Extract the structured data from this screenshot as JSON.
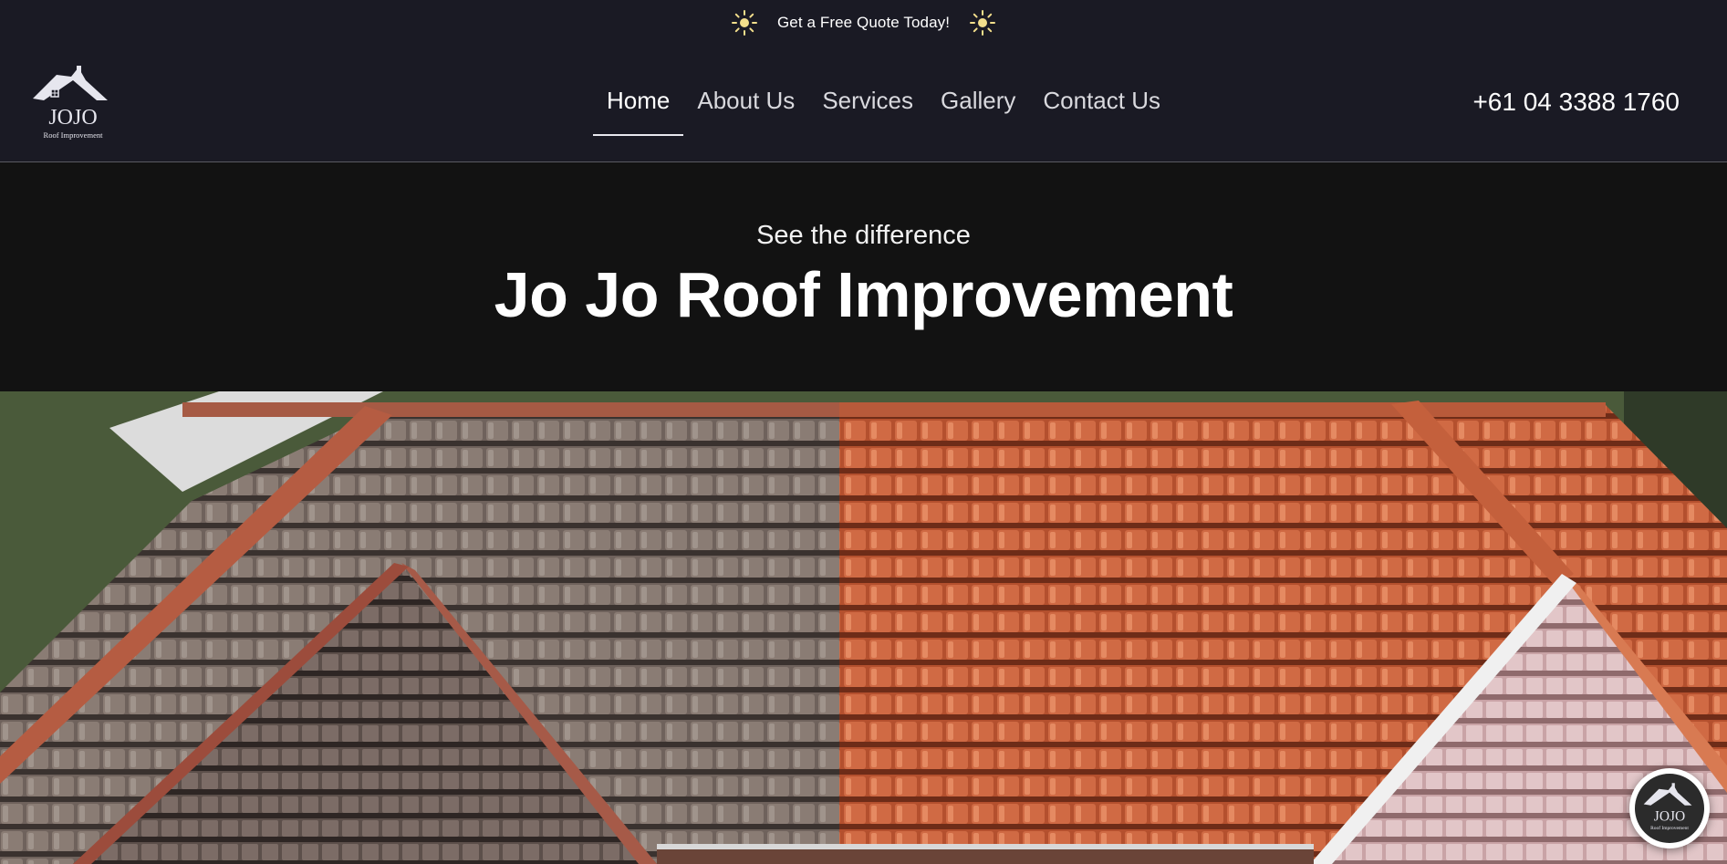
{
  "announcement": {
    "text": "Get a Free Quote Today!",
    "icon": "sun-icon",
    "icon_color": "#f3df8c"
  },
  "header": {
    "logo": {
      "brand": "JOJO",
      "tagline": "Roof Improvement"
    },
    "nav": [
      {
        "label": "Home",
        "active": true
      },
      {
        "label": "About Us",
        "active": false
      },
      {
        "label": "Services",
        "active": false
      },
      {
        "label": "Gallery",
        "active": false
      },
      {
        "label": "Contact Us",
        "active": false
      }
    ],
    "phone": "+61 04 3388 1760"
  },
  "hero": {
    "subtitle": "See the difference",
    "title": "Jo Jo Roof Improvement"
  },
  "colors": {
    "header_bg": "#1a1a24",
    "hero_bg": "#121212",
    "roof_before": "#7d6a62",
    "roof_after": "#c95a36"
  }
}
